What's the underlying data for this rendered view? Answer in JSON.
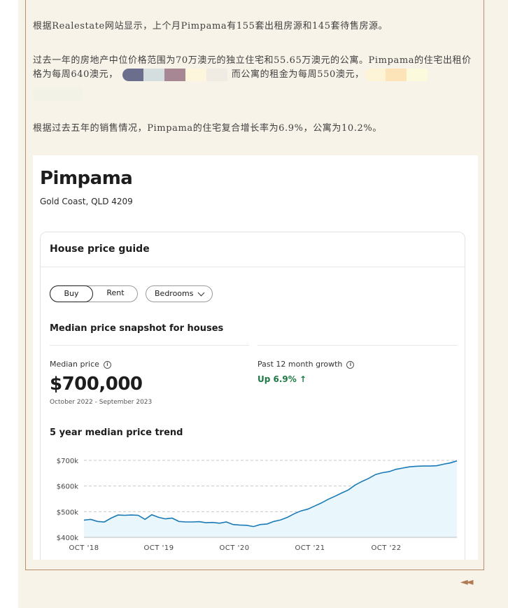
{
  "article": {
    "p1": "根据Realestate网站显示，上个月Pimpama有155套出租房源和145套待售房源。",
    "p2a": "过去一年的房地产中位价格范围为70万澳元的独立住宅和55.65万澳元的公寓。Pimpama的住宅出租价格为每周640澳元，",
    "p2b": "而公寓的租金为每周550澳元，",
    "p3": "根据过去五年的销售情况，Pimpama的住宅复合增长率为6.9%，公寓为10.2%。"
  },
  "swatches": [
    "#6b6e8c",
    "#d4dede",
    "#a78793",
    "#fdf6dc",
    "#f1ece3"
  ],
  "swatches2": [
    "#fdf3d6",
    "#fde3b8",
    "#fbfadc"
  ],
  "card": {
    "suburb": "Pimpama",
    "location": "Gold Coast, QLD 4209",
    "guide_title": "House price guide",
    "buy_label": "Buy",
    "rent_label": "Rent",
    "bedrooms_label": "Bedrooms",
    "snapshot_title": "Median price snapshot for houses",
    "median_label": "Median price",
    "median_value": "$700,000",
    "median_period": "October 2022 - September 2023",
    "growth_label": "Past 12 month growth",
    "growth_value": "Up 6.9%",
    "growth_arrow": "↑",
    "trend_title": "5 year median price trend",
    "info_glyph": "i"
  },
  "nav_glyph": "◄◄",
  "chart_data": {
    "type": "area",
    "title": "5 year median price trend",
    "xlabel": "",
    "ylabel": "",
    "x_ticks": [
      "OCT '18",
      "OCT '19",
      "OCT '20",
      "OCT '21",
      "OCT '22"
    ],
    "y_ticks": [
      "$400k",
      "$500k",
      "$600k",
      "$700k"
    ],
    "ylim": [
      400000,
      700000
    ],
    "grid": true,
    "line_color": "#1a7ab8",
    "fill_color": "#e9f6fc",
    "series": [
      {
        "values": [
          467000,
          470000,
          462000,
          460000,
          475000,
          487000,
          486000,
          487000,
          486000,
          470000,
          488000,
          478000,
          472000,
          475000,
          462000,
          460000,
          460000,
          461000,
          457000,
          458000,
          455000,
          460000,
          450000,
          448000,
          447000,
          442000,
          450000,
          452000,
          462000,
          468000,
          478000,
          492000,
          503000,
          510000,
          522000,
          534000,
          548000,
          560000,
          573000,
          585000,
          604000,
          618000,
          630000,
          645000,
          652000,
          656000,
          665000,
          670000,
          675000,
          677000,
          678000,
          678000,
          679000,
          685000,
          690000,
          698000
        ]
      }
    ]
  }
}
